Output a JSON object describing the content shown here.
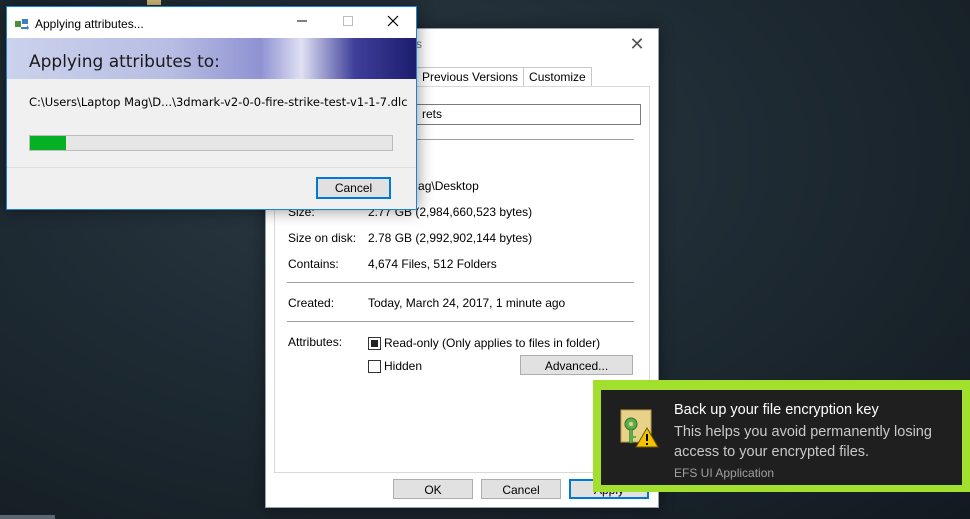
{
  "properties_window": {
    "title_fragment": "s",
    "tabs": [
      {
        "label": "Previous Versions"
      },
      {
        "label": "Customize"
      }
    ],
    "name_value": "rets",
    "location_fragment": "Laptop Mag\\Desktop",
    "rows": {
      "size_label": "Size:",
      "size_value": "2.77 GB (2,984,660,523 bytes)",
      "size_on_disk_label": "Size on disk:",
      "size_on_disk_value": "2.78 GB (2,992,902,144 bytes)",
      "contains_label": "Contains:",
      "contains_value": "4,674 Files, 512 Folders",
      "created_label": "Created:",
      "created_value": "Today, March 24, 2017, 1 minute ago",
      "attributes_label": "Attributes:"
    },
    "readonly_label": "Read-only (Only applies to files in folder)",
    "hidden_label": "Hidden",
    "advanced_button": "Advanced...",
    "ok_button": "OK",
    "cancel_button": "Cancel",
    "apply_button_fragment": "Apply"
  },
  "apply_dialog": {
    "title": "Applying attributes...",
    "heading": "Applying attributes to:",
    "path": "C:\\Users\\Laptop Mag\\D...\\3dmark-v2-0-0-fire-strike-test-v1-1-7.dlc",
    "progress_fraction": 0.1,
    "progress_color": "#06b025",
    "cancel_button": "Cancel",
    "minimize_icon": "minimize-icon",
    "maximize_icon": "maximize-icon",
    "close_icon": "close-icon"
  },
  "toast": {
    "title": "Back up your file encryption key",
    "body": "This helps you avoid permanently losing access to your encrypted files.",
    "source": "EFS UI Application",
    "icon": "key-warning-icon",
    "highlight_color": "#a3e02d"
  }
}
